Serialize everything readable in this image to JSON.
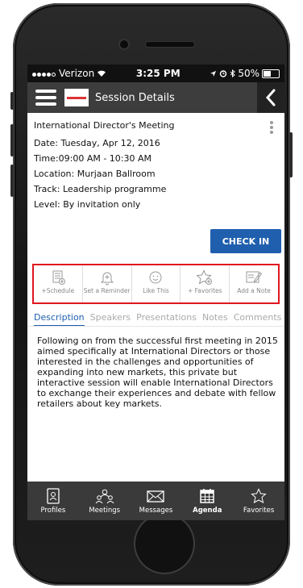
{
  "status": {
    "carrier": "Verizon",
    "time": "3:25 PM",
    "battery": "50%"
  },
  "nav": {
    "title": "Session Details"
  },
  "session": {
    "title": "International Director's Meeting",
    "date": "Date: Tuesday, Apr 12, 2016",
    "time": "Time:09:00 AM - 10:30 AM",
    "location": "Location: Murjaan Ballroom",
    "track": "Track:  Leadership programme",
    "level": "Level:  By invitation only"
  },
  "checkin_label": "CHECK IN",
  "actions": [
    {
      "label": "+Schedule",
      "icon": "schedule-icon"
    },
    {
      "label": "Set a Reminder",
      "icon": "bell-icon"
    },
    {
      "label": "Like This",
      "icon": "smiley-icon"
    },
    {
      "label": "+ Favorites",
      "icon": "star-icon"
    },
    {
      "label": "Add a Note",
      "icon": "note-icon"
    }
  ],
  "tabs": [
    "Description",
    "Speakers",
    "Presentations",
    "Notes",
    "Comments"
  ],
  "active_tab": "Description",
  "description": "Following on from the successful first meeting in 2015 aimed specifically at International Directors or those interested in the challenges and opportunities of expanding into new markets, this private but interactive session will enable International Directors to exchange their experiences and debate with fellow retailers about key markets.",
  "bottom_nav": [
    {
      "label": "Profiles",
      "icon": "profile-card-icon"
    },
    {
      "label": "Meetings",
      "icon": "meetings-icon"
    },
    {
      "label": "Messages",
      "icon": "envelope-icon"
    },
    {
      "label": "Agenda",
      "icon": "calendar-icon"
    },
    {
      "label": "Favorites",
      "icon": "star-icon"
    }
  ],
  "active_bottom": "Agenda",
  "colors": {
    "accent": "#1f5fae",
    "highlight_border": "#e0161e",
    "navbar": "#3d3d3d",
    "tabbar": "#3a3a3a"
  }
}
